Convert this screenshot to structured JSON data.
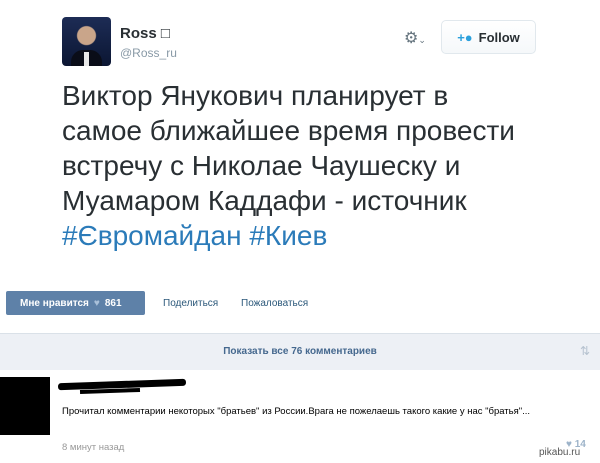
{
  "tweet": {
    "name": "Ross □",
    "handle": "@Ross_ru",
    "follow_label": "Follow",
    "text_lines": [
      "Виктор Янукович планирует в",
      "самое ближайшее время провести",
      "встречу с Николае Чаушеску и",
      "Муамаром Каддафи - источник"
    ],
    "hashtags": [
      "#Євромайдан",
      "#Киев"
    ]
  },
  "vk": {
    "like_label": "Мне нравится",
    "like_count": "861",
    "share_label": "Поделиться",
    "report_label": "Пожаловаться",
    "show_comments_label": "Показать все 76 комментариев"
  },
  "comment": {
    "text": "Прочитал комментарии некоторых \"братьев\" из России.Врага не пожелаешь такого какие у нас \"братья\"...",
    "time": "8 минут назад",
    "likes": "14"
  },
  "watermark": "pikabu.ru",
  "colors": {
    "hashtag": "#2b7bb9",
    "like_button": "#5e81a8",
    "vk_link": "#2b587a",
    "comments_bar": "#edf0f5"
  },
  "icons": {
    "gear": "gear-icon",
    "follow": "add-user-icon",
    "heart": "heart-icon",
    "sort": "sort-arrows-icon"
  }
}
